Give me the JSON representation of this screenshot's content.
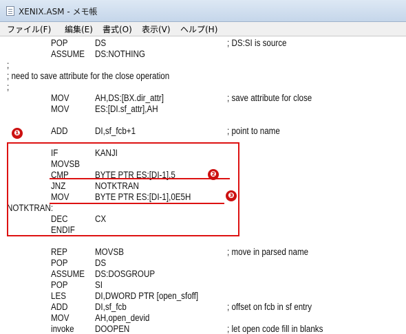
{
  "window": {
    "title": "XENIX.ASM - メモ帳"
  },
  "menu": [
    {
      "label": "ファイル(F)"
    },
    {
      "label": "編集(E)"
    },
    {
      "label": "書式(O)"
    },
    {
      "label": "表示(V)"
    },
    {
      "label": "ヘルプ(H)"
    }
  ],
  "lines": [
    {
      "label": "",
      "op": "POP",
      "args": "DS",
      "comment": "; DS:SI is source"
    },
    {
      "label": "",
      "op": "ASSUME",
      "args": "DS:NOTHING",
      "comment": ""
    },
    {
      "text": ";"
    },
    {
      "text": "; need to save attribute for the close operation"
    },
    {
      "text": ";"
    },
    {
      "label": "",
      "op": "MOV",
      "args": "AH,DS:[BX.dir_attr]",
      "comment": "; save attribute for close"
    },
    {
      "label": "",
      "op": "MOV",
      "args": "ES:[DI.sf_attr],AH",
      "comment": ""
    },
    {
      "label": "",
      "op": "ADD",
      "args": "DI,sf_fcb+1",
      "comment": "; point to name"
    },
    {
      "label": "",
      "op": "IF",
      "args": "KANJI",
      "comment": ""
    },
    {
      "label": "",
      "op": "MOVSB",
      "args": "",
      "comment": ""
    },
    {
      "label": "",
      "op": "CMP",
      "args": "BYTE PTR ES:[DI-1],5",
      "comment": ""
    },
    {
      "label": "",
      "op": "JNZ",
      "args": "NOTKTRAN",
      "comment": ""
    },
    {
      "label": "",
      "op": "MOV",
      "args": "BYTE PTR ES:[DI-1],0E5H",
      "comment": ""
    },
    {
      "label": "NOTKTRAN:",
      "op": "",
      "args": "",
      "comment": ""
    },
    {
      "label": "",
      "op": "DEC",
      "args": "CX",
      "comment": ""
    },
    {
      "label": "",
      "op": "ENDIF",
      "args": "",
      "comment": ""
    },
    {
      "label": "",
      "op": "REP",
      "args": "MOVSB",
      "comment": "; move in parsed name"
    },
    {
      "label": "",
      "op": "POP",
      "args": "DS",
      "comment": ""
    },
    {
      "label": "",
      "op": "ASSUME",
      "args": "DS:DOSGROUP",
      "comment": ""
    },
    {
      "label": "",
      "op": "POP",
      "args": "SI",
      "comment": ""
    },
    {
      "label": "",
      "op": "LES",
      "args": "DI,DWORD PTR [open_sfoff]",
      "comment": ""
    },
    {
      "label": "",
      "op": "ADD",
      "args": "DI,sf_fcb",
      "comment": "; offset on fcb in sf entry"
    },
    {
      "label": "",
      "op": "MOV",
      "args": "AH,open_devid",
      "comment": ""
    },
    {
      "label": "",
      "op": "invoke",
      "args": "DOOPEN",
      "comment": "; let open code fill in blanks"
    }
  ],
  "markers": [
    "❶",
    "❷",
    "❸"
  ],
  "colors": {
    "highlight": "#dd1111",
    "marker": "#cc1111"
  }
}
